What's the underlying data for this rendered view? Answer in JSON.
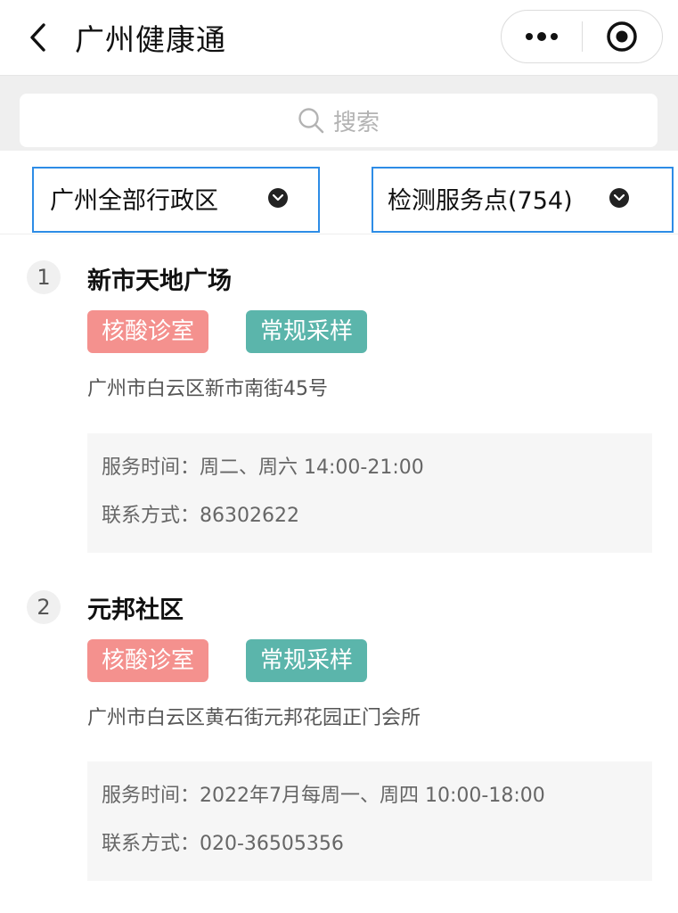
{
  "nav": {
    "title": "广州健康通"
  },
  "search": {
    "placeholder": "搜索"
  },
  "filters": {
    "district": "广州全部行政区",
    "points": "检测服务点(754)"
  },
  "items": [
    {
      "index": "1",
      "name": "新市天地广场",
      "tags": [
        "核酸诊室",
        "常规采样"
      ],
      "address": "广州市白云区新市南街45号",
      "service_time": "服务时间：周二、周六 14:00-21:00",
      "contact": "联系方式：86302622"
    },
    {
      "index": "2",
      "name": "元邦社区",
      "tags": [
        "核酸诊室",
        "常规采样"
      ],
      "address": "广州市白云区黄石街元邦花园正门会所",
      "service_time": "服务时间：2022年7月每周一、周四 10:00-18:00",
      "contact": "联系方式：020-36505356"
    }
  ],
  "colors": {
    "tag_pink": "#f4918e",
    "tag_teal": "#5bb5ab",
    "filter_border": "#2d8ce6"
  },
  "icons": [
    "back-arrow-icon",
    "more-dots-icon",
    "close-target-icon",
    "search-icon",
    "caret-down-icon"
  ]
}
